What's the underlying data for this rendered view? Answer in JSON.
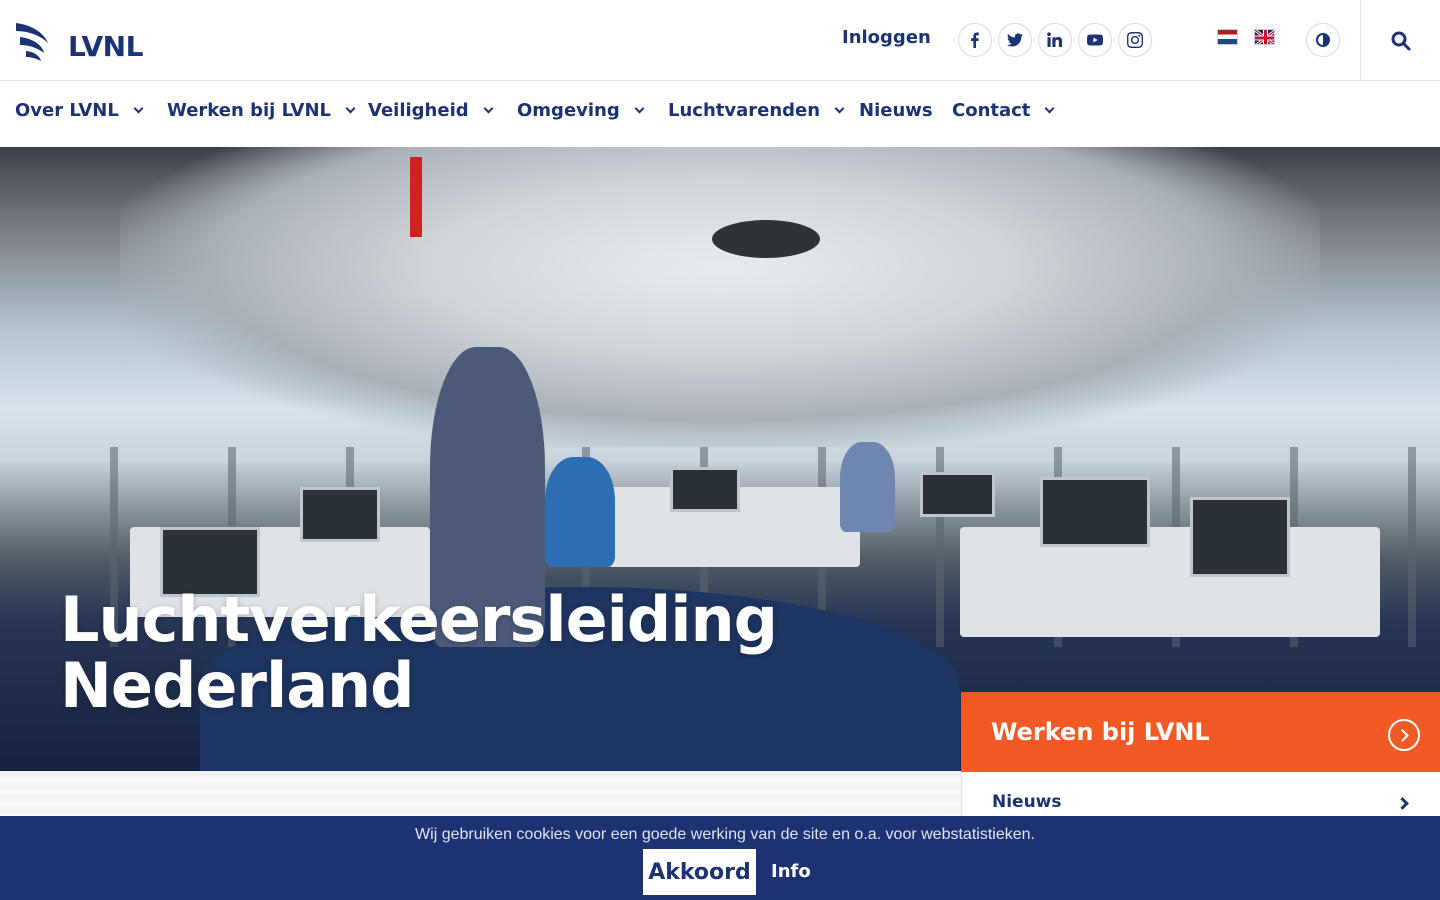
{
  "brand": {
    "name": "LVNL",
    "color_primary": "#1c3273",
    "color_accent": "#f15a24"
  },
  "header": {
    "login_label": "Inloggen",
    "socials": [
      "facebook-icon",
      "twitter-icon",
      "linkedin-icon",
      "youtube-icon",
      "instagram-icon"
    ],
    "languages": [
      "nl",
      "en"
    ]
  },
  "nav": {
    "items": [
      {
        "label": "Over LVNL",
        "has_dropdown": true
      },
      {
        "label": "Werken bij LVNL",
        "has_dropdown": true
      },
      {
        "label": "Veiligheid",
        "has_dropdown": true
      },
      {
        "label": "Omgeving",
        "has_dropdown": true
      },
      {
        "label": "Luchtvarenden",
        "has_dropdown": true
      },
      {
        "label": "Nieuws",
        "has_dropdown": false
      },
      {
        "label": "Contact",
        "has_dropdown": true
      }
    ]
  },
  "hero": {
    "title_line1": "Luchtverkeersleiding",
    "title_line2": "Nederland"
  },
  "panel": {
    "cta_label": "Werken bij LVNL",
    "link_label": "Nieuws"
  },
  "cookie": {
    "text": "Wij gebruiken cookies voor een goede werking van de site en o.a. voor webstatistieken.",
    "accept_label": "Akkoord",
    "info_label": "Info"
  }
}
